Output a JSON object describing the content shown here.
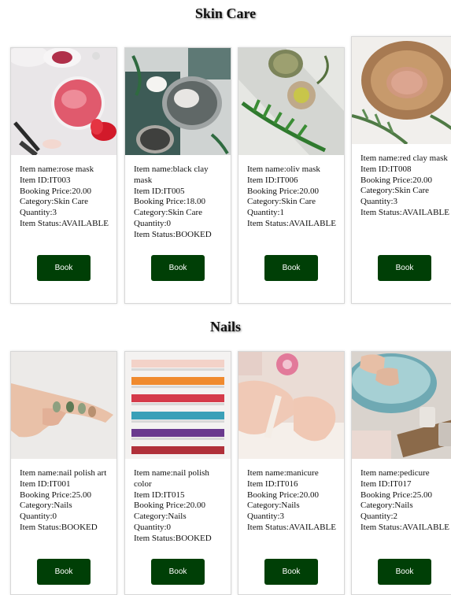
{
  "sections": [
    {
      "title": "Skin Care",
      "items": [
        {
          "name_label": "Item name:rose mask",
          "id_label": "Item ID:IT003",
          "price_label": "Booking Price:20.00",
          "category_label": "Category:Skin Care",
          "quantity_label": "Quantity:3",
          "status_label": "Item Status:AVAILABLE",
          "button": "Book"
        },
        {
          "name_label": "Item name:black clay mask",
          "id_label": "Item ID:IT005",
          "price_label": "Booking Price:18.00",
          "category_label": "Category:Skin Care",
          "quantity_label": "Quantity:0",
          "status_label": "Item Status:BOOKED",
          "button": "Book"
        },
        {
          "name_label": "Item name:oliv mask",
          "id_label": "Item ID:IT006",
          "price_label": "Booking Price:20.00",
          "category_label": "Category:Skin Care",
          "quantity_label": "Quantity:1",
          "status_label": "Item Status:AVAILABLE",
          "button": "Book"
        },
        {
          "name_label": "Item name:red clay mask",
          "id_label": "Item ID:IT008",
          "price_label": "Booking Price:20.00",
          "category_label": "Category:Skin Care",
          "quantity_label": "Quantity:3",
          "status_label": "Item Status:AVAILABLE",
          "button": "Book"
        }
      ]
    },
    {
      "title": "Nails",
      "items": [
        {
          "name_label": "Item name:nail polish art",
          "id_label": "Item ID:IT001",
          "price_label": "Booking Price:25.00",
          "category_label": "Category:Nails",
          "quantity_label": "Quantity:0",
          "status_label": "Item Status:BOOKED",
          "button": "Book"
        },
        {
          "name_label": "Item name:nail polish color",
          "id_label": "Item ID:IT015",
          "price_label": "Booking Price:20.00",
          "category_label": "Category:Nails",
          "quantity_label": "Quantity:0",
          "status_label": "Item Status:BOOKED",
          "button": "Book"
        },
        {
          "name_label": "Item name:manicure",
          "id_label": "Item ID:IT016",
          "price_label": "Booking Price:20.00",
          "category_label": "Category:Nails",
          "quantity_label": "Quantity:3",
          "status_label": "Item Status:AVAILABLE",
          "button": "Book"
        },
        {
          "name_label": "Item name:pedicure",
          "id_label": "Item ID:IT017",
          "price_label": "Booking Price:25.00",
          "category_label": "Category:Nails",
          "quantity_label": "Quantity:2",
          "status_label": "Item Status:AVAILABLE",
          "button": "Book"
        }
      ]
    }
  ],
  "colors": {
    "button": "#003f06",
    "button_text": "#ffffff",
    "card_border": "#d7d7d7"
  }
}
